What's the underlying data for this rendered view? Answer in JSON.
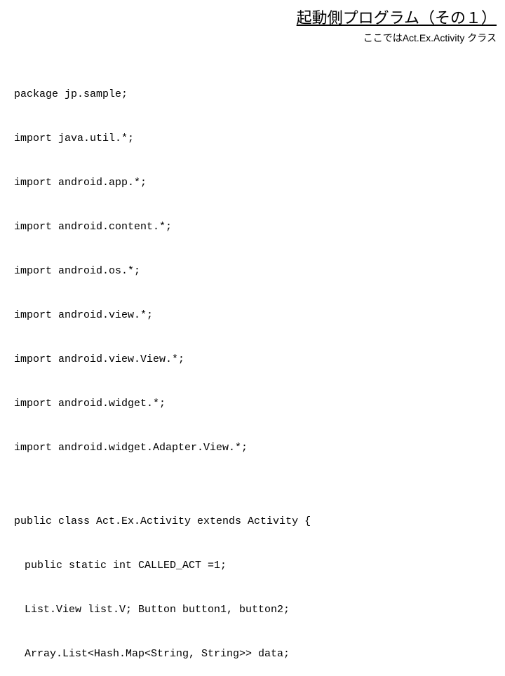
{
  "header": {
    "title": "起動側プログラム（その１）",
    "subtitle": "ここではAct.Ex.Activity クラス"
  },
  "code": {
    "lines": [
      "package jp.sample;",
      "import java.util.*;",
      "import android.app.*;",
      "import android.content.*;",
      "import android.os.*;",
      "import android.view.*;",
      "import android.view.View.*;",
      "import android.widget.*;",
      "import android.widget.Adapter.View.*;",
      "",
      "public class Act.Ex.Activity extends Activity {",
      "　public static int CALLED_ACT =1;",
      "　List.View list.V; Button button1, button2;",
      "　Array.List<Hash.Map<String, String>> data;"
    ]
  }
}
